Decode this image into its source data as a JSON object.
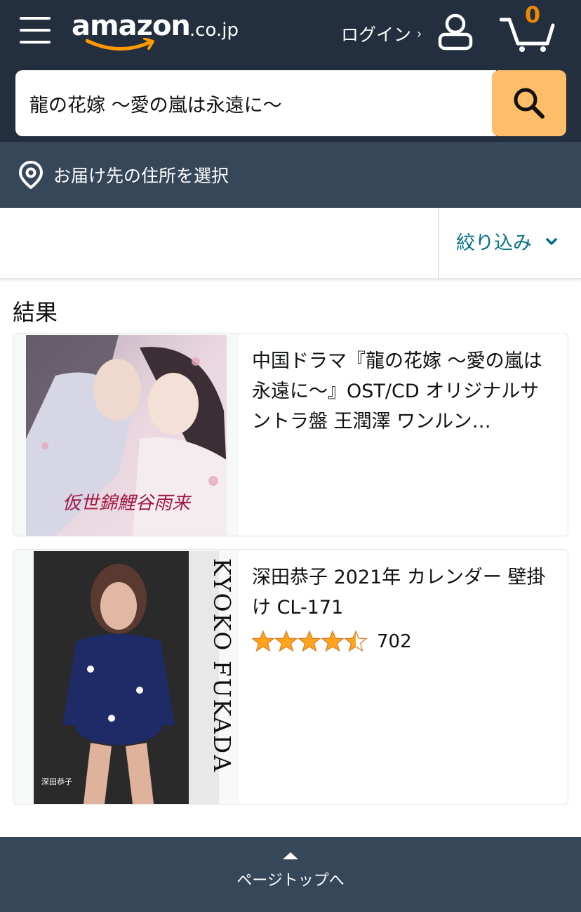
{
  "header": {
    "logo_text": "amazon",
    "logo_suffix": ".co.jp",
    "login_label": "ログイン",
    "login_chevron": "›",
    "cart_count": "0",
    "icons": [
      "menu-icon",
      "user-icon",
      "cart-icon",
      "search-icon"
    ]
  },
  "search": {
    "value": "龍の花嫁 〜愛の嵐は永遠に〜"
  },
  "delivery": {
    "label": "お届け先の住所を選択",
    "icon": "location-pin-icon"
  },
  "filter": {
    "label": "絞り込み",
    "icon": "chevron-down-icon"
  },
  "results": {
    "title": "結果",
    "items": [
      {
        "title": "中国ドラマ『龍の花嫁 〜愛の嵐は永遠に〜』OST/CD オリジナルサントラ盤 王潤澤 ワンルン…",
        "image_text": "仮世錦鯉谷雨来"
      },
      {
        "title": "深田恭子 2021年 カレンダー 壁掛け CL-171",
        "rating": 4.5,
        "rating_count": "702",
        "image_text": "KYOKO FUKADA",
        "image_subtext": "深田恭子"
      }
    ]
  },
  "footer": {
    "back_to_top": "ページトップへ"
  },
  "colors": {
    "header_bg": "#232f3e",
    "delivery_bg": "#37475a",
    "search_button": "#febd69",
    "cart_count": "#f08804",
    "link": "#007185",
    "star": "#ffa41c"
  }
}
